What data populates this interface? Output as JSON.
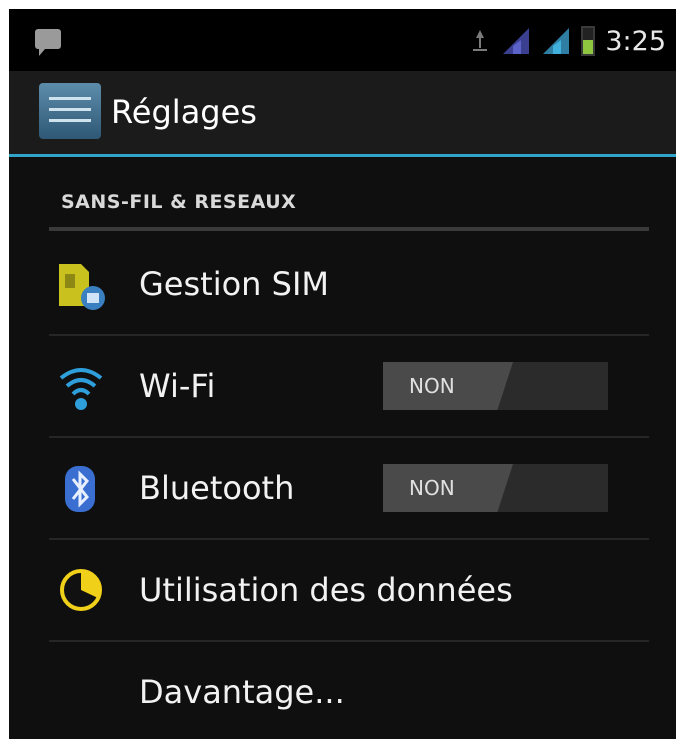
{
  "statusbar": {
    "time": "3:25",
    "icons": [
      "notification-icon",
      "sync-icon",
      "signal-sim1-icon",
      "signal-sim2-icon",
      "battery-icon"
    ],
    "battery_level": 0.55
  },
  "actionbar": {
    "title": "Réglages",
    "icon": "settings-app-icon",
    "accent_color": "#33a4c9"
  },
  "section": {
    "title": "SANS-FIL & RESEAUX"
  },
  "items": [
    {
      "label": "Gestion SIM",
      "icon": "sim-card-icon"
    },
    {
      "label": "Wi-Fi",
      "icon": "wifi-icon",
      "toggle": "NON"
    },
    {
      "label": "Bluetooth",
      "icon": "bluetooth-icon",
      "toggle": "NON"
    },
    {
      "label": "Utilisation des données",
      "icon": "data-usage-icon"
    },
    {
      "label": "Davantage...",
      "icon": ""
    }
  ]
}
